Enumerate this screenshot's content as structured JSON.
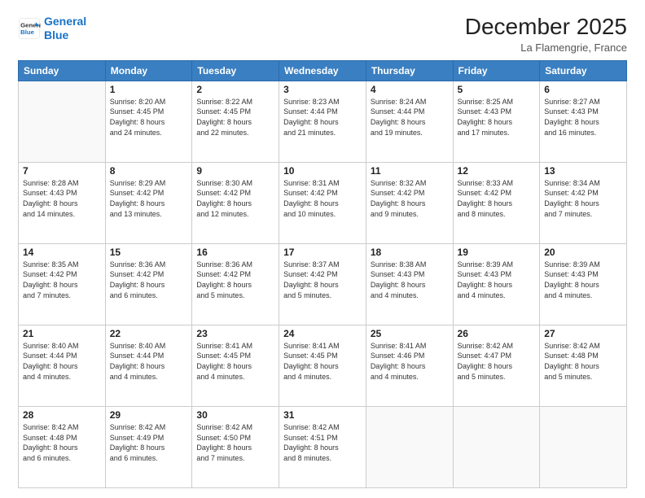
{
  "logo": {
    "line1": "General",
    "line2": "Blue"
  },
  "title": "December 2025",
  "subtitle": "La Flamengrie, France",
  "header_days": [
    "Sunday",
    "Monday",
    "Tuesday",
    "Wednesday",
    "Thursday",
    "Friday",
    "Saturday"
  ],
  "weeks": [
    [
      {
        "day": "",
        "info": ""
      },
      {
        "day": "1",
        "info": "Sunrise: 8:20 AM\nSunset: 4:45 PM\nDaylight: 8 hours\nand 24 minutes."
      },
      {
        "day": "2",
        "info": "Sunrise: 8:22 AM\nSunset: 4:45 PM\nDaylight: 8 hours\nand 22 minutes."
      },
      {
        "day": "3",
        "info": "Sunrise: 8:23 AM\nSunset: 4:44 PM\nDaylight: 8 hours\nand 21 minutes."
      },
      {
        "day": "4",
        "info": "Sunrise: 8:24 AM\nSunset: 4:44 PM\nDaylight: 8 hours\nand 19 minutes."
      },
      {
        "day": "5",
        "info": "Sunrise: 8:25 AM\nSunset: 4:43 PM\nDaylight: 8 hours\nand 17 minutes."
      },
      {
        "day": "6",
        "info": "Sunrise: 8:27 AM\nSunset: 4:43 PM\nDaylight: 8 hours\nand 16 minutes."
      }
    ],
    [
      {
        "day": "7",
        "info": "Sunrise: 8:28 AM\nSunset: 4:43 PM\nDaylight: 8 hours\nand 14 minutes."
      },
      {
        "day": "8",
        "info": "Sunrise: 8:29 AM\nSunset: 4:42 PM\nDaylight: 8 hours\nand 13 minutes."
      },
      {
        "day": "9",
        "info": "Sunrise: 8:30 AM\nSunset: 4:42 PM\nDaylight: 8 hours\nand 12 minutes."
      },
      {
        "day": "10",
        "info": "Sunrise: 8:31 AM\nSunset: 4:42 PM\nDaylight: 8 hours\nand 10 minutes."
      },
      {
        "day": "11",
        "info": "Sunrise: 8:32 AM\nSunset: 4:42 PM\nDaylight: 8 hours\nand 9 minutes."
      },
      {
        "day": "12",
        "info": "Sunrise: 8:33 AM\nSunset: 4:42 PM\nDaylight: 8 hours\nand 8 minutes."
      },
      {
        "day": "13",
        "info": "Sunrise: 8:34 AM\nSunset: 4:42 PM\nDaylight: 8 hours\nand 7 minutes."
      }
    ],
    [
      {
        "day": "14",
        "info": "Sunrise: 8:35 AM\nSunset: 4:42 PM\nDaylight: 8 hours\nand 7 minutes."
      },
      {
        "day": "15",
        "info": "Sunrise: 8:36 AM\nSunset: 4:42 PM\nDaylight: 8 hours\nand 6 minutes."
      },
      {
        "day": "16",
        "info": "Sunrise: 8:36 AM\nSunset: 4:42 PM\nDaylight: 8 hours\nand 5 minutes."
      },
      {
        "day": "17",
        "info": "Sunrise: 8:37 AM\nSunset: 4:42 PM\nDaylight: 8 hours\nand 5 minutes."
      },
      {
        "day": "18",
        "info": "Sunrise: 8:38 AM\nSunset: 4:43 PM\nDaylight: 8 hours\nand 4 minutes."
      },
      {
        "day": "19",
        "info": "Sunrise: 8:39 AM\nSunset: 4:43 PM\nDaylight: 8 hours\nand 4 minutes."
      },
      {
        "day": "20",
        "info": "Sunrise: 8:39 AM\nSunset: 4:43 PM\nDaylight: 8 hours\nand 4 minutes."
      }
    ],
    [
      {
        "day": "21",
        "info": "Sunrise: 8:40 AM\nSunset: 4:44 PM\nDaylight: 8 hours\nand 4 minutes."
      },
      {
        "day": "22",
        "info": "Sunrise: 8:40 AM\nSunset: 4:44 PM\nDaylight: 8 hours\nand 4 minutes."
      },
      {
        "day": "23",
        "info": "Sunrise: 8:41 AM\nSunset: 4:45 PM\nDaylight: 8 hours\nand 4 minutes."
      },
      {
        "day": "24",
        "info": "Sunrise: 8:41 AM\nSunset: 4:45 PM\nDaylight: 8 hours\nand 4 minutes."
      },
      {
        "day": "25",
        "info": "Sunrise: 8:41 AM\nSunset: 4:46 PM\nDaylight: 8 hours\nand 4 minutes."
      },
      {
        "day": "26",
        "info": "Sunrise: 8:42 AM\nSunset: 4:47 PM\nDaylight: 8 hours\nand 5 minutes."
      },
      {
        "day": "27",
        "info": "Sunrise: 8:42 AM\nSunset: 4:48 PM\nDaylight: 8 hours\nand 5 minutes."
      }
    ],
    [
      {
        "day": "28",
        "info": "Sunrise: 8:42 AM\nSunset: 4:48 PM\nDaylight: 8 hours\nand 6 minutes."
      },
      {
        "day": "29",
        "info": "Sunrise: 8:42 AM\nSunset: 4:49 PM\nDaylight: 8 hours\nand 6 minutes."
      },
      {
        "day": "30",
        "info": "Sunrise: 8:42 AM\nSunset: 4:50 PM\nDaylight: 8 hours\nand 7 minutes."
      },
      {
        "day": "31",
        "info": "Sunrise: 8:42 AM\nSunset: 4:51 PM\nDaylight: 8 hours\nand 8 minutes."
      },
      {
        "day": "",
        "info": ""
      },
      {
        "day": "",
        "info": ""
      },
      {
        "day": "",
        "info": ""
      }
    ]
  ]
}
